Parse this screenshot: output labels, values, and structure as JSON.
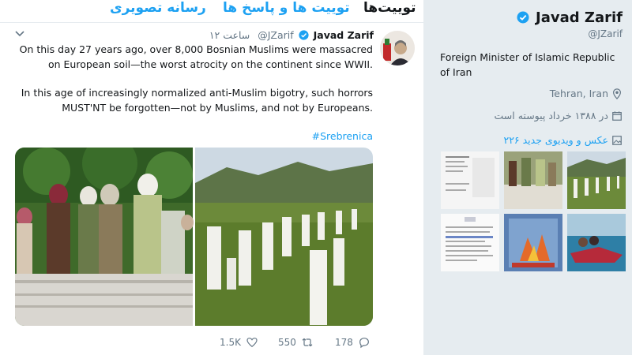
{
  "tabs": [
    {
      "label": "رسانه تصویری"
    },
    {
      "label": "توییت ها و پاسخ ها"
    },
    {
      "label": "توییت‌ها"
    }
  ],
  "tweet": {
    "author_name": "Javad Zarif",
    "author_handle": "@JZarif",
    "time": "۱۲ ساعت",
    "text_1": "On this day 27 years ago, over 8,000 Bosnian Muslims were massacred on European soil—the worst atrocity on the continent since WWII.",
    "text_2": "In this age of increasingly normalized anti-Muslim bigotry, such horrors MUST'NT be forgotten—not by Muslims, and not by Europeans.",
    "hashtag": "#Srebrenica",
    "likes": "1.5K",
    "retweets": "550",
    "replies": "178"
  },
  "profile": {
    "name": "Javad Zarif",
    "handle": "@JZarif",
    "bio": "Foreign Minister of Islamic Republic of Iran",
    "location": "Tehran, Iran",
    "joined": "در ۱۳۸۸ خرداد پیوسته است",
    "media_count": "۲۲۶ عکس و ویدیوی جدید"
  },
  "colors": {
    "accent": "#1da1f2",
    "muted": "#657786",
    "background": "#e6ecf0"
  },
  "icons": [
    "chevron-down-icon",
    "verified-icon",
    "like-icon",
    "retweet-icon",
    "reply-icon",
    "location-icon",
    "calendar-icon",
    "media-icon"
  ]
}
